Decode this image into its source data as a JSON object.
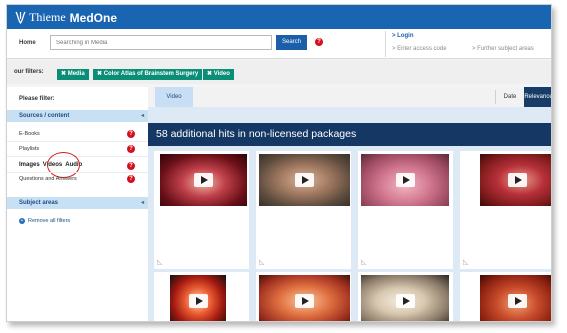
{
  "header": {
    "brand": "Thieme",
    "product": "MedOne",
    "home_label": "Home",
    "search_placeholder": "Searching in Media",
    "search_button": "Search",
    "help_icon": "?",
    "login": "> Login",
    "access_code": "> Enter access code",
    "subject_areas": "> Further subject areas"
  },
  "filters": {
    "label": "our filters:",
    "chips": [
      "✖ Media",
      "✖ Color Atlas of Brainstem Surgery",
      "✖ Video"
    ]
  },
  "sidebar": {
    "title": "Please filter:",
    "sources_header": "Sources / content",
    "items": [
      "E-Books",
      "Playlists",
      "Questions and Answers"
    ],
    "media_types": [
      "Images",
      "Videos",
      "Audio"
    ],
    "subject_header": "Subject areas",
    "remove_filters": "Remove all filters"
  },
  "main": {
    "tab_video": "Video",
    "sort_date": "Date",
    "sort_relevance": "Relevance",
    "hits_banner": "58 additional hits in non-licensed packages"
  },
  "icons": {
    "play": "play-icon",
    "help": "help-icon",
    "chevron": "chevron-left-icon"
  },
  "colors": {
    "brand_blue": "#1a65b2",
    "banner_navy": "#143764",
    "chip_teal": "#0b8e78",
    "help_red": "#d5101c"
  }
}
